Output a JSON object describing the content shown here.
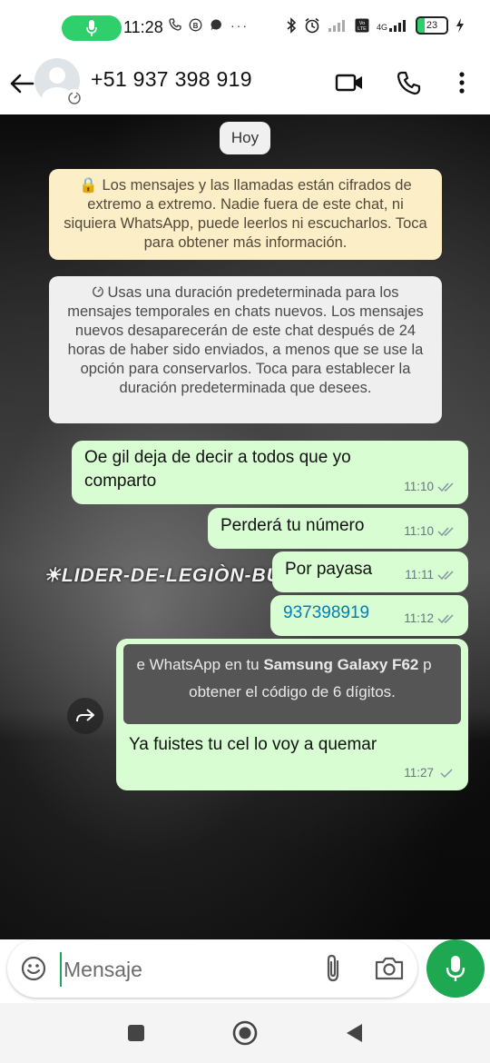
{
  "status_bar": {
    "time": "11:28",
    "icons": [
      "mic-icon",
      "phone-icon",
      "b-icon",
      "chat-bubble-icon",
      "more-dots-icon",
      "bluetooth-icon",
      "alarm-icon",
      "signal-off-icon",
      "volte-icon",
      "4g-signal-icon",
      "battery-icon",
      "charging-icon"
    ],
    "battery": "23",
    "network": "4G"
  },
  "header": {
    "contact_name": "+51 937 398 919",
    "icons": [
      "back-arrow-icon",
      "avatar",
      "video-call-icon",
      "voice-call-icon",
      "more-vert-icon"
    ]
  },
  "chat": {
    "day_label": "Hoy",
    "notice_encryption": "🔒 Los mensajes y las llamadas están cifrados de extremo a extremo. Nadie fuera de este chat, ni siquiera WhatsApp, puede leerlos ni escucharlos. Toca para obtener más información.",
    "notice_timer": "Usas una duración predeterminada para los mensajes temporales en chats nuevos. Los mensajes nuevos desaparecerán de este chat después de 24 horas de haber sido enviados, a menos que se use la opción para conservarlos. Toca para establecer la duración predeterminada que desees.",
    "wallpaper_text": "☀LIDER-DE-LEGIÒN-BUT",
    "messages": [
      {
        "text": "Oe gil deja de decir a todos que yo comparto",
        "time": "11:10",
        "status": "read"
      },
      {
        "text": "Perderá tu número",
        "time": "11:10",
        "status": "read"
      },
      {
        "text": "Por payasa",
        "time": "11:11",
        "status": "read"
      },
      {
        "text": "937398919",
        "time": "11:12",
        "status": "read"
      },
      {
        "quoted_line1_pre": "e WhatsApp en tu ",
        "quoted_line1_bold": "Samsung Galaxy F62",
        "quoted_line1_post": " p",
        "quoted_line2": "obtener el código de 6 dígitos.",
        "text": "Ya fuistes tu cel lo voy a quemar",
        "time": "11:27",
        "status": "sent"
      }
    ]
  },
  "composer": {
    "placeholder": "Mensaje"
  },
  "colors": {
    "bubble_out": "#d9fdd3",
    "encryption_notice": "#fcefc7",
    "accent_green": "#1da851",
    "link": "#027eb5"
  }
}
